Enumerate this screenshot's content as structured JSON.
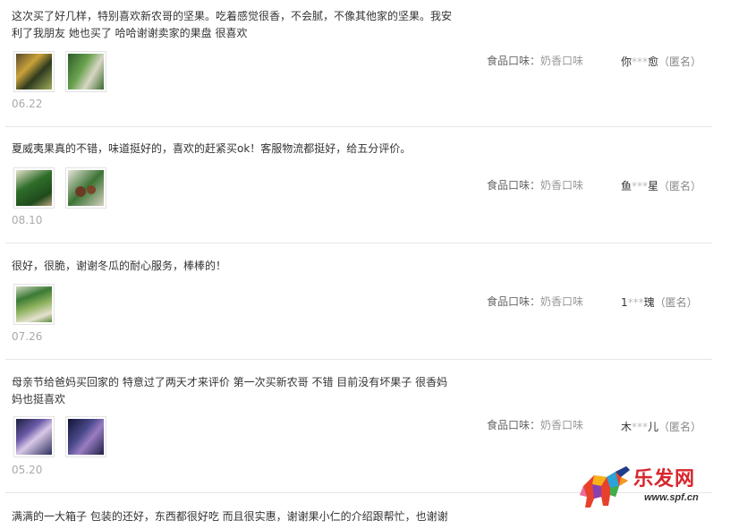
{
  "reviews": [
    {
      "text": "这次买了好几样，特别喜欢新农哥的坚果。吃着感觉很香，不会腻，不像其他家的坚果。我安利了我朋友 她也买了 哈哈谢谢卖家的果盘 很喜欢",
      "date": "06.22",
      "flavor_label": "食品口味：",
      "flavor_value": "奶香口味",
      "user_prefix": "你",
      "user_mask": "***",
      "user_suffix": "愈",
      "anon": "（匿名）",
      "images": [
        "product-photo",
        "product-photo"
      ]
    },
    {
      "text": "夏威夷果真的不错，味道挺好的，喜欢的赶紧买ok！客服物流都挺好，给五分评价。",
      "date": "08.10",
      "flavor_label": "食品口味：",
      "flavor_value": "奶香口味",
      "user_prefix": "鱼",
      "user_mask": "***",
      "user_suffix": "星",
      "anon": "（匿名）",
      "images": [
        "product-photo",
        "product-photo"
      ]
    },
    {
      "text": "很好，很脆，谢谢冬瓜的耐心服务，棒棒的！",
      "date": "07.26",
      "flavor_label": "食品口味：",
      "flavor_value": "奶香口味",
      "user_prefix": "1",
      "user_mask": "***",
      "user_suffix": "瑰",
      "anon": "（匿名）",
      "images": [
        "product-photo"
      ]
    },
    {
      "text": "母亲节给爸妈买回家的 特意过了两天才来评价 第一次买新农哥 不错 目前没有坏果子 很香妈妈也挺喜欢",
      "date": "05.20",
      "flavor_label": "食品口味：",
      "flavor_value": "奶香口味",
      "user_prefix": "木",
      "user_mask": "***",
      "user_suffix": "儿",
      "anon": "（匿名）",
      "images": [
        "product-photo",
        "product-photo"
      ]
    },
    {
      "text": "满满的一大箱子 包装的还好，东西都很好吃 而且很实惠，谢谢果小仁的介绍跟帮忙，也谢谢"
    }
  ],
  "watermark": {
    "brand": "乐发网",
    "url": "www.spf.cn",
    "colors": {
      "brand": "#d8262d",
      "url": "#333333"
    }
  }
}
